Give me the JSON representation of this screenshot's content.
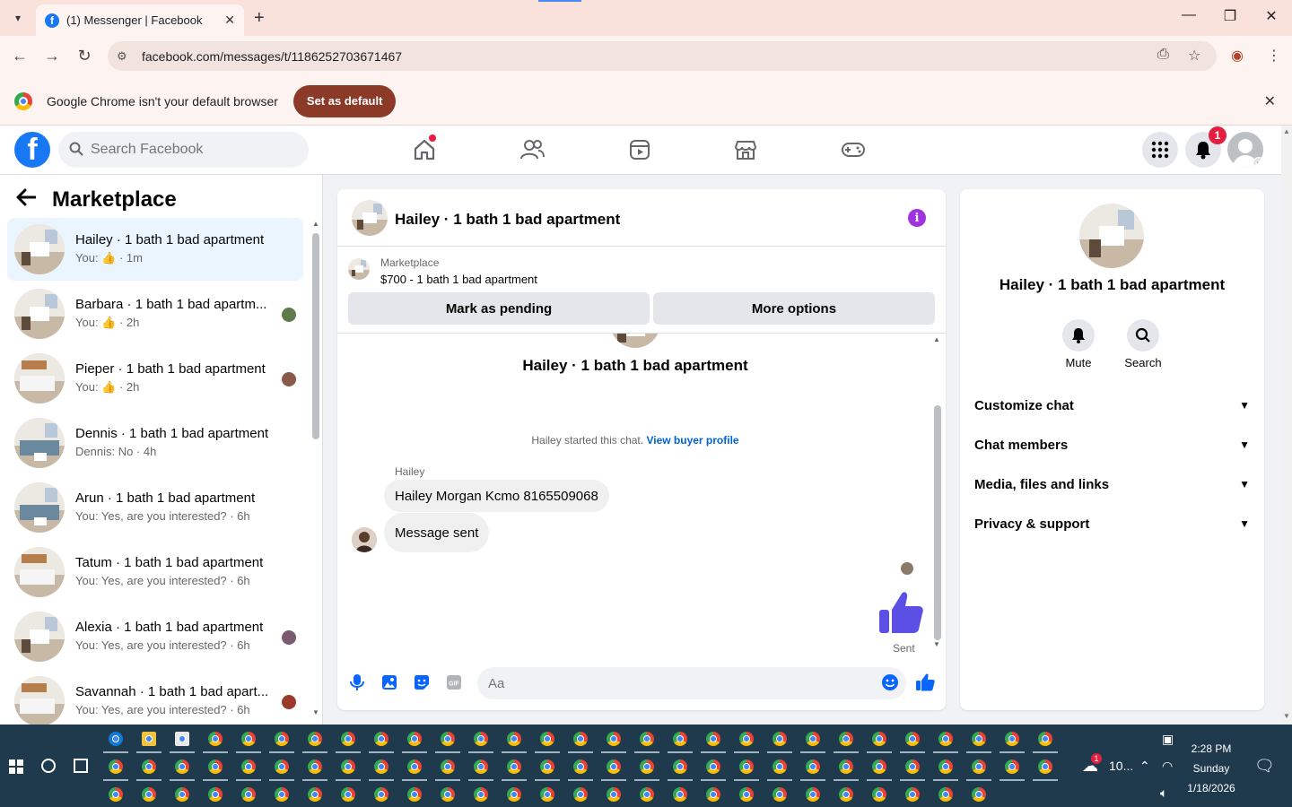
{
  "browser": {
    "tab_title": "(1) Messenger | Facebook",
    "url": "facebook.com/messages/t/1186252703671467",
    "infobar_text": "Google Chrome isn't your default browser",
    "set_default_label": "Set as default"
  },
  "fb": {
    "search_placeholder": "Search Facebook",
    "notification_count": "1"
  },
  "sidebar": {
    "title": "Marketplace",
    "conversations": [
      {
        "name": "Hailey · 1 bath 1 bad apartment",
        "preview": "You: 👍 · 1m",
        "active": true
      },
      {
        "name": "Barbara · 1 bath 1 bad apartm...",
        "preview": "You: 👍 · 2h"
      },
      {
        "name": "Pieper · 1 bath 1 bad apartment",
        "preview": "You: 👍 · 2h"
      },
      {
        "name": "Dennis · 1 bath 1 bad apartment",
        "preview": "Dennis: No · 4h"
      },
      {
        "name": "Arun · 1 bath 1 bad apartment",
        "preview": "You: Yes, are you interested? · 6h"
      },
      {
        "name": "Tatum · 1 bath 1 bad apartment",
        "preview": "You: Yes, are you interested? · 6h"
      },
      {
        "name": "Alexia · 1 bath 1 bad apartment",
        "preview": "You: Yes, are you interested? · 6h"
      },
      {
        "name": "Savannah · 1 bath 1 bad apart...",
        "preview": "You: Yes, are you interested? · 6h"
      }
    ]
  },
  "chat": {
    "title": "Hailey · 1 bath 1 bad apartment",
    "listing_label": "Marketplace",
    "listing_price": "$700 - 1 bath 1 bad apartment",
    "mark_pending": "Mark as pending",
    "more_options": "More options",
    "header_name": "Hailey · 1 bath 1 bad apartment",
    "started_text": "Hailey started this chat.",
    "buyer_profile_link": "View buyer profile",
    "sender": "Hailey",
    "messages": [
      "Hailey Morgan Kcmo 8165509068",
      "Message sent"
    ],
    "sent_label": "Sent",
    "composer_placeholder": "Aa"
  },
  "details": {
    "name": "Hailey · 1 bath 1 bad apartment",
    "mute_label": "Mute",
    "search_label": "Search",
    "sections": [
      "Customize chat",
      "Chat members",
      "Media, files and links",
      "Privacy & support"
    ]
  },
  "taskbar": {
    "time": "2:28 PM",
    "day": "Sunday",
    "date": "1/18/2026",
    "weather_temp": "10...",
    "weather_badge": "1"
  },
  "colors": {
    "fb_blue": "#1877f2",
    "messenger_purple": "#a033e0",
    "thumb_blue": "#5b4fe6",
    "active_row": "#ebf5ff",
    "set_default_btn": "#8c3a28"
  }
}
